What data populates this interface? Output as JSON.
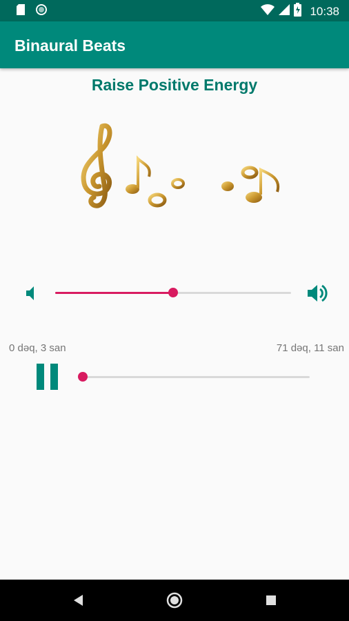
{
  "status_bar": {
    "time": "10:38",
    "icons": [
      "sd-card-icon",
      "circle-icon",
      "wifi-icon",
      "signal-icon",
      "battery-charging-icon"
    ]
  },
  "app_bar": {
    "title": "Binaural Beats"
  },
  "main": {
    "track_title": "Raise Positive Energy",
    "image": "music-notes-gold",
    "volume": {
      "level": 0.5
    },
    "player": {
      "elapsed": "0 dəq, 3 san",
      "total": "71 dəq, 11 san",
      "progress": 0.0007,
      "state": "playing"
    }
  },
  "nav_bar": {
    "buttons": [
      "back",
      "home",
      "recents"
    ]
  },
  "colors": {
    "primary": "#00897b",
    "primary_dark": "#00695c",
    "accent": "#d81b60",
    "title": "#00796b"
  }
}
